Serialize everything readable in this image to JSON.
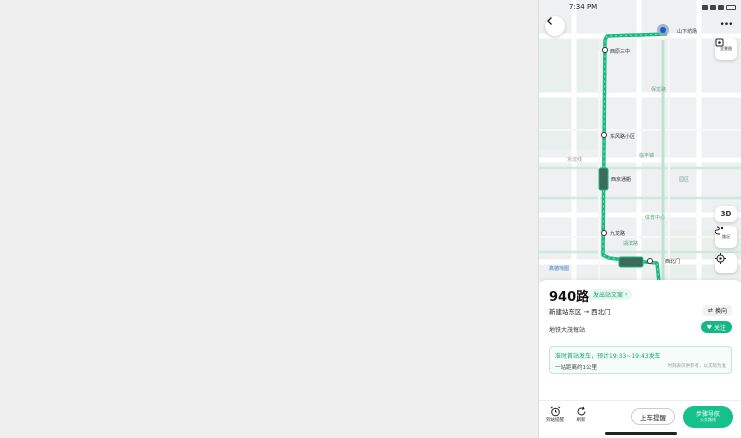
{
  "status_bar": {
    "time": "7:34 PM"
  },
  "map": {
    "labels": {
      "top_right_stop": "山下坊场",
      "stop_1": "西原三中",
      "area_1": "保龙路",
      "stop_2": "东风路小区",
      "area_2": "临丰镇",
      "road_1": "京沈线",
      "stop_3": "西京通衢",
      "area_3": "园区",
      "stop_4": "九龙路",
      "area_4": "体育中心",
      "area_5": "湖滨路",
      "stop_5": "西北门",
      "watermark": "高德地图"
    },
    "side_buttons": {
      "layers_label": "全景图",
      "three_d": "3D",
      "route_label": "路况"
    }
  },
  "sheet": {
    "route_name": "940路",
    "tag_label": "发出站文案",
    "direction_from": "新建站东区",
    "direction_to": "西北门",
    "reverse_label": "换向",
    "subway_info": "地铁大茂每站",
    "follow_label": "关注",
    "timetable": {
      "main": "准时首站发车，预计19:33~19:43发车",
      "sub": "一站距离约1公里",
      "note": "时刻表仅供参考，以实际为准"
    }
  },
  "bottom_bar": {
    "alarm_label": "到站提醒",
    "refresh_label": "刷新",
    "remind_label": "上车提醒",
    "nav_label": "步骤导航",
    "nav_sub": "公交路线"
  }
}
